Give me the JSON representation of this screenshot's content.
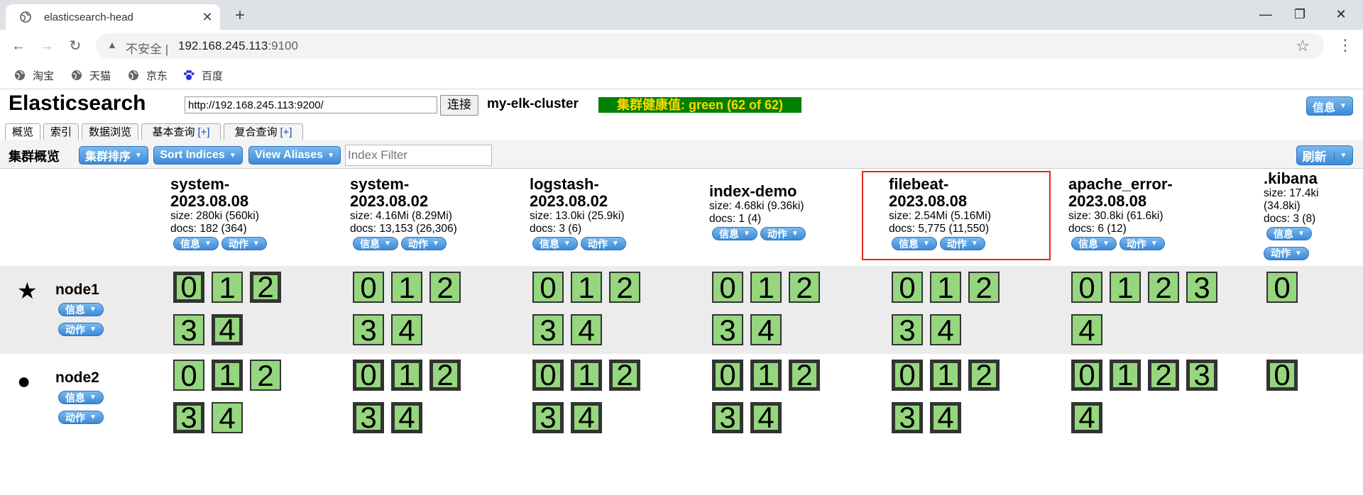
{
  "browser": {
    "tab_title": "elasticsearch-head",
    "insecure_label": "不安全",
    "url_host": "192.168.245.113",
    "url_port": ":9100",
    "bookmarks": [
      "淘宝",
      "天猫",
      "京东",
      "百度"
    ]
  },
  "app": {
    "brand": "Elasticsearch",
    "connection_url": "http://192.168.245.113:9200/",
    "connect_label": "连接",
    "cluster_name": "my-elk-cluster",
    "health": "集群健康值: green (62 of 62)",
    "info_label": "信息",
    "tabs": [
      {
        "label": "概览",
        "plus": ""
      },
      {
        "label": "索引",
        "plus": ""
      },
      {
        "label": "数据浏览",
        "plus": ""
      },
      {
        "label": "基本查询",
        "plus": "[+]"
      },
      {
        "label": "复合查询",
        "plus": "[+]"
      }
    ],
    "overview_label": "集群概览",
    "sort_cluster_label": "集群排序",
    "sort_indices_label": "Sort Indices",
    "view_aliases_label": "View Aliases",
    "index_filter_placeholder": "Index Filter",
    "refresh_label": "刷新",
    "btn_info": "信息",
    "btn_action": "动作"
  },
  "indices": [
    {
      "name": "system-\n2023.08.08",
      "size": "size: 280ki (560ki)",
      "docs": "docs: 182 (364)"
    },
    {
      "name": "system-\n2023.08.02",
      "size": "size: 4.16Mi (8.29Mi)",
      "docs": "docs: 13,153 (26,306)"
    },
    {
      "name": "logstash-\n2023.08.02",
      "size": "size: 13.0ki (25.9ki)",
      "docs": "docs: 3 (6)"
    },
    {
      "name": "index-demo",
      "size": "size: 4.68ki (9.36ki)",
      "docs": "docs: 1 (4)"
    },
    {
      "name": "filebeat-\n2023.08.08",
      "size": "size: 2.54Mi (5.16Mi)",
      "docs": "docs: 5,775 (11,550)"
    },
    {
      "name": "apache_error-\n2023.08.08",
      "size": "size: 30.8ki (61.6ki)",
      "docs": "docs: 6 (12)"
    },
    {
      "name": ".kibana",
      "size": "size: 17.4ki\n(34.8ki)",
      "docs": "docs: 3 (8)"
    }
  ],
  "nodes": [
    {
      "name": "node1",
      "icon": "star-icon",
      "shards": [
        [
          {
            "n": "0",
            "p": true
          },
          {
            "n": "1",
            "p": false
          },
          {
            "n": "2",
            "p": true
          },
          {
            "n": "3",
            "p": false
          },
          {
            "n": "4",
            "p": true
          }
        ],
        [
          {
            "n": "0",
            "p": false
          },
          {
            "n": "1",
            "p": false
          },
          {
            "n": "2",
            "p": false
          },
          {
            "n": "3",
            "p": false
          },
          {
            "n": "4",
            "p": false
          }
        ],
        [
          {
            "n": "0",
            "p": false
          },
          {
            "n": "1",
            "p": false
          },
          {
            "n": "2",
            "p": false
          },
          {
            "n": "3",
            "p": false
          },
          {
            "n": "4",
            "p": false
          }
        ],
        [
          {
            "n": "0",
            "p": false
          },
          {
            "n": "1",
            "p": false
          },
          {
            "n": "2",
            "p": false
          },
          {
            "n": "3",
            "p": false
          },
          {
            "n": "4",
            "p": false
          }
        ],
        [
          {
            "n": "0",
            "p": false
          },
          {
            "n": "1",
            "p": false
          },
          {
            "n": "2",
            "p": false
          },
          {
            "n": "3",
            "p": false
          },
          {
            "n": "4",
            "p": false
          }
        ],
        [
          {
            "n": "0",
            "p": false
          },
          {
            "n": "1",
            "p": false
          },
          {
            "n": "2",
            "p": false
          },
          {
            "n": "3",
            "p": false
          },
          {
            "n": "4",
            "p": false
          }
        ],
        [
          {
            "n": "0",
            "p": false
          }
        ]
      ]
    },
    {
      "name": "node2",
      "icon": "circle-icon",
      "shards": [
        [
          {
            "n": "0",
            "p": false
          },
          {
            "n": "1",
            "p": true
          },
          {
            "n": "2",
            "p": false
          },
          {
            "n": "3",
            "p": true
          },
          {
            "n": "4",
            "p": false
          }
        ],
        [
          {
            "n": "0",
            "p": true
          },
          {
            "n": "1",
            "p": true
          },
          {
            "n": "2",
            "p": true
          },
          {
            "n": "3",
            "p": true
          },
          {
            "n": "4",
            "p": true
          }
        ],
        [
          {
            "n": "0",
            "p": true
          },
          {
            "n": "1",
            "p": true
          },
          {
            "n": "2",
            "p": true
          },
          {
            "n": "3",
            "p": true
          },
          {
            "n": "4",
            "p": true
          }
        ],
        [
          {
            "n": "0",
            "p": true
          },
          {
            "n": "1",
            "p": true
          },
          {
            "n": "2",
            "p": true
          },
          {
            "n": "3",
            "p": true
          },
          {
            "n": "4",
            "p": true
          }
        ],
        [
          {
            "n": "0",
            "p": true
          },
          {
            "n": "1",
            "p": true
          },
          {
            "n": "2",
            "p": true
          },
          {
            "n": "3",
            "p": true
          },
          {
            "n": "4",
            "p": true
          }
        ],
        [
          {
            "n": "0",
            "p": true
          },
          {
            "n": "1",
            "p": true
          },
          {
            "n": "2",
            "p": true
          },
          {
            "n": "3",
            "p": true
          },
          {
            "n": "4",
            "p": true
          }
        ],
        [
          {
            "n": "0",
            "p": true
          }
        ]
      ]
    }
  ]
}
